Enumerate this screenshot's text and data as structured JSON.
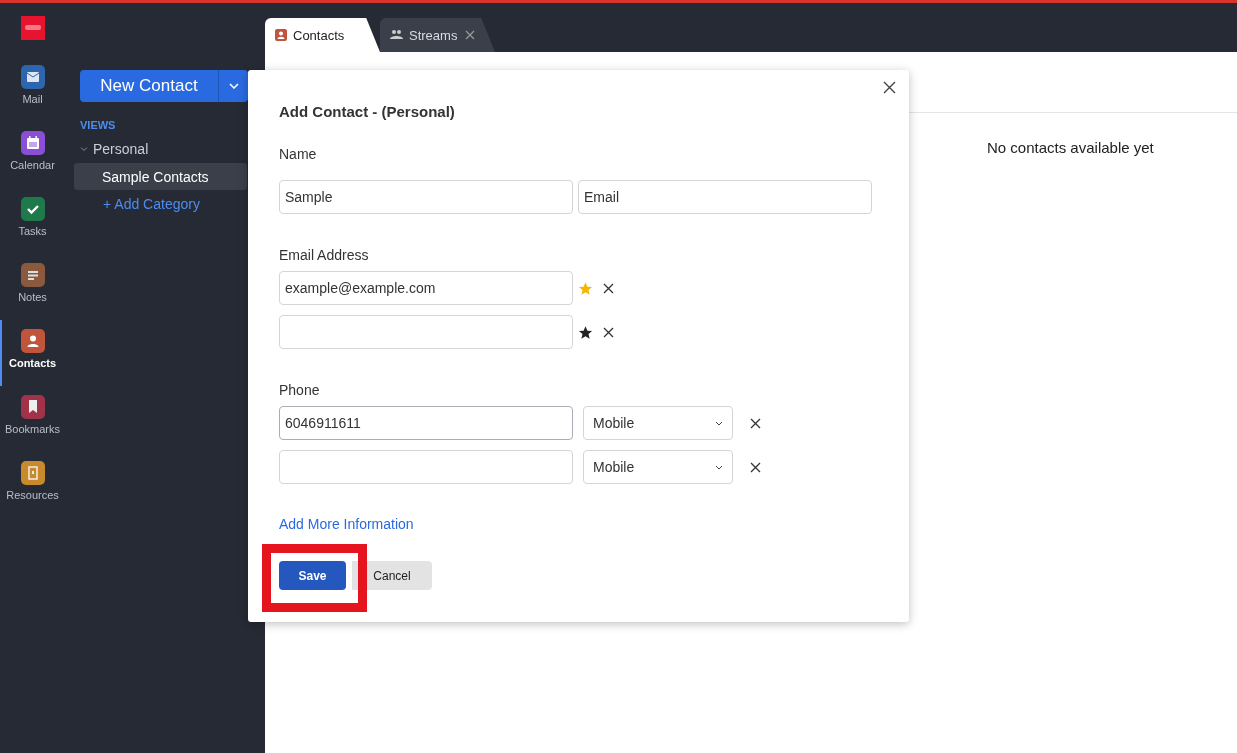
{
  "app_rail": {
    "items": [
      {
        "kind": "mail",
        "label": "Mail",
        "selected": false
      },
      {
        "kind": "calendar",
        "label": "Calendar",
        "selected": false
      },
      {
        "kind": "tasks",
        "label": "Tasks",
        "selected": false
      },
      {
        "kind": "notes",
        "label": "Notes",
        "selected": false
      },
      {
        "kind": "contacts",
        "label": "Contacts",
        "selected": true
      },
      {
        "kind": "bookmarks",
        "label": "Bookmarks",
        "selected": false
      },
      {
        "kind": "resources",
        "label": "Resources",
        "selected": false
      }
    ]
  },
  "sidebar": {
    "new_button": "New Contact",
    "section": "VIEWS",
    "group": {
      "label": "Personal",
      "expanded": true,
      "children": [
        {
          "label": "Sample Contacts",
          "selected": true
        }
      ]
    },
    "add_link": "+ Add Category"
  },
  "tabs": [
    {
      "kind": "contacts",
      "label": "Contacts",
      "selected": true,
      "closable": false
    },
    {
      "kind": "streams",
      "label": "Streams",
      "selected": false,
      "closable": true
    }
  ],
  "main": {
    "empty_message": "No contacts available yet"
  },
  "dialog": {
    "title": "Add Contact - (Personal)",
    "name_label": "Name",
    "name_fields": [
      "Sample",
      "Email"
    ],
    "email_label": "Email Address",
    "emails": [
      {
        "value": "example@example.com",
        "primary": true
      },
      {
        "primary": false
      }
    ],
    "phone_label": "Phone",
    "phones": [
      {
        "value": "6046911611",
        "type": "Mobile",
        "focused": true
      },
      {
        "type": "Mobile",
        "focused": false
      }
    ],
    "more_link": "Add More Information",
    "save": "Save",
    "cancel": "Cancel",
    "save_highlighted": true
  }
}
